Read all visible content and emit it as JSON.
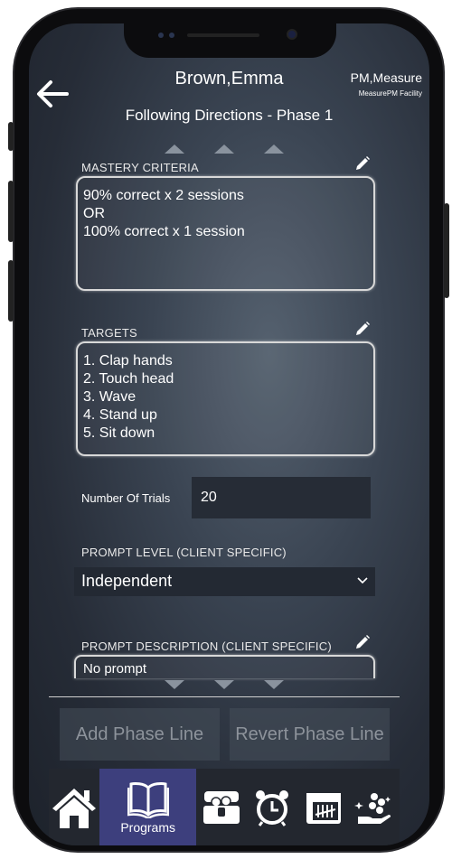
{
  "header": {
    "client_name": "Brown,Emma",
    "user": "PM,Measure",
    "facility": "MeasurePM Facility",
    "program_title": "Following Directions - Phase 1"
  },
  "mastery": {
    "label": "MASTERY CRITERIA",
    "lines": [
      "90% correct x 2 sessions",
      "OR",
      "100% correct x 1 session"
    ]
  },
  "targets": {
    "label": "TARGETS",
    "lines": [
      "1. Clap hands",
      "2. Touch head",
      "3. Wave",
      "4. Stand up",
      "5. Sit down"
    ]
  },
  "trials": {
    "label": "Number Of Trials",
    "value": "20"
  },
  "prompt_level": {
    "label": "PROMPT LEVEL (CLIENT SPECIFIC)",
    "value": "Independent"
  },
  "prompt_description": {
    "label": "PROMPT DESCRIPTION (CLIENT SPECIFIC)",
    "value": "No prompt"
  },
  "buttons": {
    "add": "Add Phase Line",
    "revert": "Revert Phase Line"
  },
  "nav": {
    "active": "Programs",
    "items": [
      "home-icon",
      "programs-icon",
      "treasure-chest-icon",
      "alarm-clock-icon",
      "tally-calendar-icon",
      "rewards-hand-icon"
    ]
  },
  "colors": {
    "nav_active": "#3d3f7d"
  }
}
